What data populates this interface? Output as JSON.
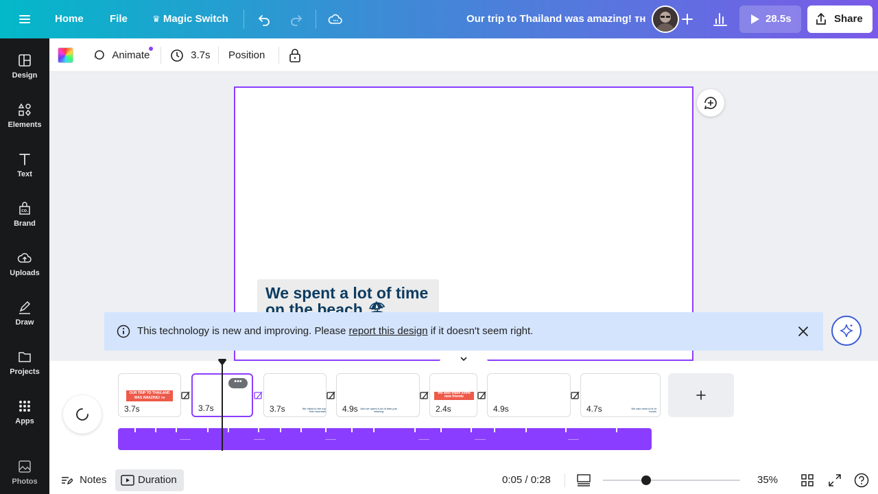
{
  "topbar": {
    "home": "Home",
    "file": "File",
    "magic_switch": "Magic Switch",
    "title": "Our trip to Thailand was amazing! ᴛʜ",
    "play_duration": "28.5s",
    "share": "Share"
  },
  "toolbar": {
    "animate": "Animate",
    "duration": "3.7s",
    "position": "Position"
  },
  "sidebar": {
    "items": [
      {
        "label": "Design",
        "icon": "design-icon"
      },
      {
        "label": "Elements",
        "icon": "elements-icon"
      },
      {
        "label": "Text",
        "icon": "text-icon"
      },
      {
        "label": "Brand",
        "icon": "brand-icon"
      },
      {
        "label": "Uploads",
        "icon": "uploads-icon"
      },
      {
        "label": "Draw",
        "icon": "draw-icon"
      },
      {
        "label": "Projects",
        "icon": "projects-icon"
      },
      {
        "label": "Apps",
        "icon": "apps-icon"
      },
      {
        "label": "Photos",
        "icon": "photos-icon"
      }
    ]
  },
  "canvas": {
    "heading": "We spent a lot of time on the beach 🏖"
  },
  "banner": {
    "text_before": "This technology is new and improving. Please ",
    "link": "report this design",
    "text_after": " if it doesn't seem right."
  },
  "timeline": {
    "clips": [
      {
        "duration": "3.7s",
        "caption": "OUR TRIP TO THAILAND WAS AMAZING! ᴛʜ"
      },
      {
        "duration": "3.7s",
        "caption": ""
      },
      {
        "duration": "3.7s",
        "caption": "We hiked to the top this mountain"
      },
      {
        "duration": "4.9s",
        "caption": "And we spent a lot of time just relaxing"
      },
      {
        "duration": "2.4s",
        "caption": "We also made some new friends"
      },
      {
        "duration": "4.9s",
        "caption": ""
      },
      {
        "duration": "4.7s",
        "caption": "We also read a lot of books"
      }
    ]
  },
  "bottombar": {
    "notes": "Notes",
    "duration": "Duration",
    "time": "0:05 / 0:28",
    "zoom": "35%"
  },
  "colors": {
    "accent": "#8b3dff",
    "heading": "#0d3c61",
    "banner_bg": "#d4e4fd"
  }
}
